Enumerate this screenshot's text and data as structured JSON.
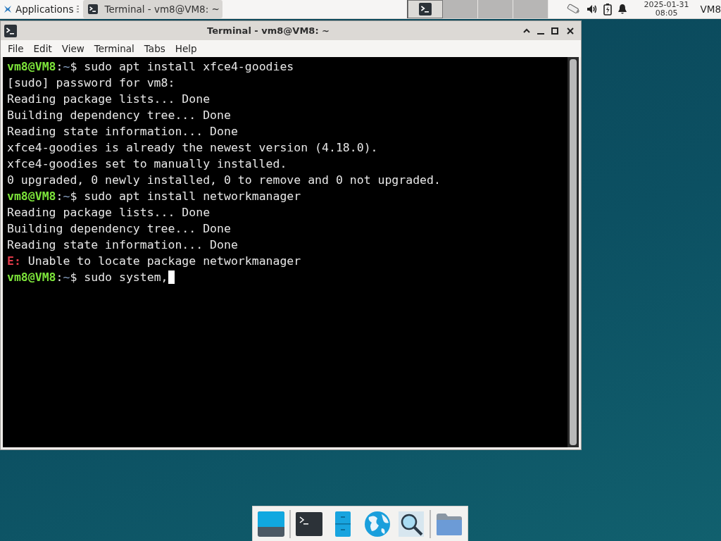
{
  "panel": {
    "app_menu": "Applications",
    "tasks": [
      {
        "title": "Terminal - vm8@VM8: ~",
        "selected": true
      }
    ],
    "workspaces": [
      {
        "selected": true,
        "has_window": true
      },
      {
        "selected": false,
        "has_window": false
      },
      {
        "selected": false,
        "has_window": false
      },
      {
        "selected": false,
        "has_window": false
      }
    ],
    "clock": {
      "date": "2025-01-31",
      "time": "08:05"
    },
    "user": "VM8"
  },
  "window": {
    "title": "Terminal - vm8@VM8: ~",
    "menu": [
      "File",
      "Edit",
      "View",
      "Terminal",
      "Tabs",
      "Help"
    ],
    "lines": [
      {
        "kind": "prompt",
        "user": "vm8@VM8",
        "separator": ":",
        "path": "~",
        "symbol": "$",
        "command": "sudo apt install xfce4-goodies",
        "cursor": false
      },
      {
        "kind": "output",
        "text": "[sudo] password for vm8:"
      },
      {
        "kind": "output",
        "text": "Reading package lists... Done"
      },
      {
        "kind": "output",
        "text": "Building dependency tree... Done"
      },
      {
        "kind": "output",
        "text": "Reading state information... Done"
      },
      {
        "kind": "output",
        "text": "xfce4-goodies is already the newest version (4.18.0)."
      },
      {
        "kind": "output",
        "text": "xfce4-goodies set to manually installed."
      },
      {
        "kind": "output",
        "text": "0 upgraded, 0 newly installed, 0 to remove and 0 not upgraded."
      },
      {
        "kind": "prompt",
        "user": "vm8@VM8",
        "separator": ":",
        "path": "~",
        "symbol": "$",
        "command": "sudo apt install networkmanager",
        "cursor": false
      },
      {
        "kind": "output",
        "text": "Reading package lists... Done"
      },
      {
        "kind": "output",
        "text": "Building dependency tree... Done"
      },
      {
        "kind": "output",
        "text": "Reading state information... Done"
      },
      {
        "kind": "error",
        "tag": "E:",
        "text": "Unable to locate package networkmanager"
      },
      {
        "kind": "prompt",
        "user": "vm8@VM8",
        "separator": ":",
        "path": "~",
        "symbol": "$",
        "command": "sudo system,",
        "cursor": true
      }
    ]
  }
}
